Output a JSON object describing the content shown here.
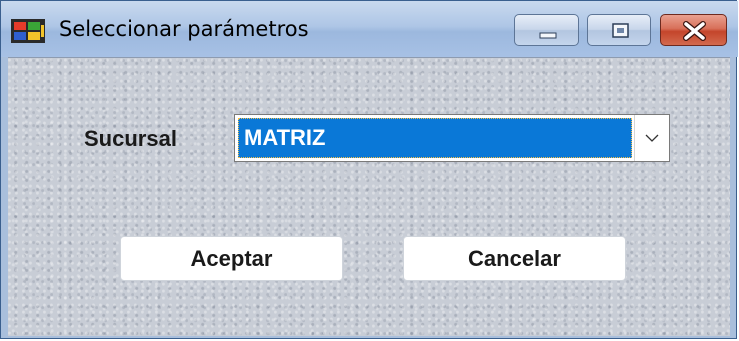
{
  "window": {
    "title": "Seleccionar parámetros",
    "app_icon": "windows-flag-icon",
    "caption_buttons": [
      "minimize-icon",
      "maximize-icon",
      "close-icon"
    ]
  },
  "form": {
    "sucursal_label": "Sucursal",
    "sucursal_value": "MATRIZ",
    "accept_label": "Aceptar",
    "cancel_label": "Cancelar"
  },
  "colors": {
    "selection": "#0a78d7",
    "close_button": "#c4452b",
    "titlebar": "#aec6e6"
  }
}
